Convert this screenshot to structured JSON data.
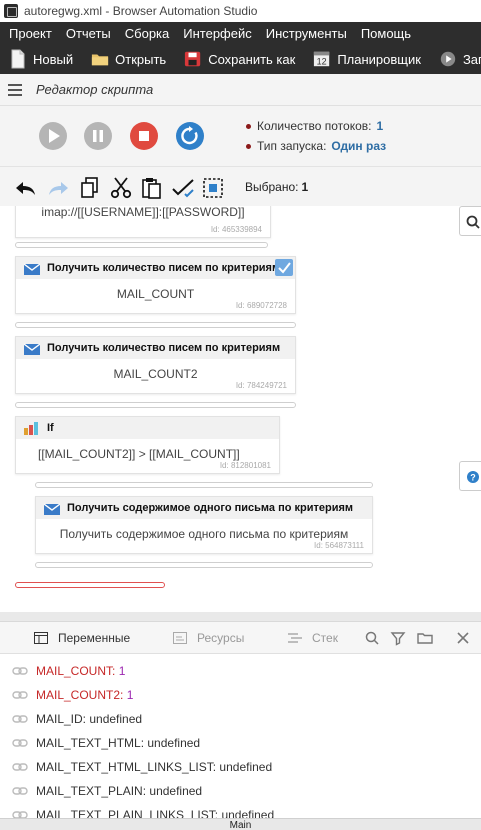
{
  "window": {
    "title": "autoregwg.xml - Browser Automation Studio"
  },
  "menu": [
    "Проект",
    "Отчеты",
    "Сборка",
    "Интерфейс",
    "Инструменты",
    "Помощь"
  ],
  "toolbar": {
    "new_label": "Новый",
    "open_label": "Открыть",
    "save_as_label": "Сохранить как",
    "scheduler_label": "Планировщик",
    "run_label": "Запус"
  },
  "editor": {
    "title": "Редактор скрипта"
  },
  "run_info": {
    "threads_label": "Количество потоков:",
    "threads_value": "1",
    "launch_label": "Тип запуска:",
    "launch_value": "Один раз"
  },
  "edit_toolbar": {
    "selected_label": "Выбрано:",
    "selected_value": "1"
  },
  "script": {
    "blocks": [
      {
        "header": "",
        "body": "imap://[[USERNAME]]:[[PASSWORD]]",
        "id": "Id: 465339894"
      },
      {
        "header": "Получить количество писем по критериям",
        "body": "MAIL_COUNT",
        "id": "Id: 689072728"
      },
      {
        "header": "Получить количество писем по критериям",
        "body": "MAIL_COUNT2",
        "id": "Id: 784249721"
      },
      {
        "header": "If",
        "body": "[[MAIL_COUNT2]] > [[MAIL_COUNT]]",
        "id": "Id: 812801081"
      },
      {
        "header": "Получить содержимое одного письма по критериям",
        "body": "Получить содержимое одного письма по критериям",
        "id": "Id: 564873111"
      }
    ]
  },
  "bottom_panel": {
    "tabs": {
      "variables": "Переменные",
      "resources": "Ресурсы",
      "stack": "Стек"
    },
    "variables": [
      {
        "name": "MAIL_COUNT:",
        "value": "1",
        "changed": true
      },
      {
        "name": "MAIL_COUNT2:",
        "value": "1",
        "changed": true
      },
      {
        "name": "MAIL_ID:",
        "value": "undefined",
        "changed": false
      },
      {
        "name": "MAIL_TEXT_HTML:",
        "value": "undefined",
        "changed": false
      },
      {
        "name": "MAIL_TEXT_HTML_LINKS_LIST:",
        "value": "undefined",
        "changed": false
      },
      {
        "name": "MAIL_TEXT_PLAIN:",
        "value": "undefined",
        "changed": false
      },
      {
        "name": "MAIL_TEXT_PLAIN_LINKS_LIST:",
        "value": "undefined",
        "changed": false
      }
    ]
  },
  "status": {
    "text": "Main"
  },
  "colors": {
    "dark_bar": "#2d2d2d",
    "accent_blue": "#2e6da4",
    "variable_changed": "#c62828",
    "value_changed": "#9c27b0"
  }
}
